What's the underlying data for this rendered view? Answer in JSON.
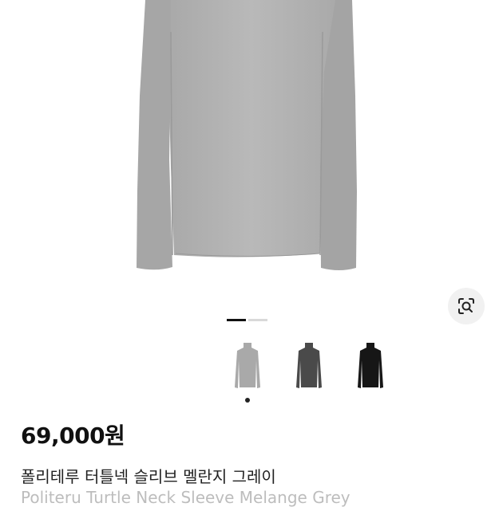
{
  "product": {
    "price": "69,000원",
    "name": "폴리테루 터틀넥 슬리브 멜란지 그레이",
    "name_en": "Politeru Turtle Neck Sleeve Melange Grey"
  },
  "gallery": {
    "pages": 2,
    "current_page": 1,
    "hero_color": "#b3b3b3",
    "lens_icon": "camera-lens-search-icon"
  },
  "colors": [
    {
      "name": "melange-grey",
      "hex": "#a9a9a9",
      "selected": true
    },
    {
      "name": "charcoal",
      "hex": "#4a4a4a",
      "selected": false
    },
    {
      "name": "black",
      "hex": "#161616",
      "selected": false
    }
  ]
}
